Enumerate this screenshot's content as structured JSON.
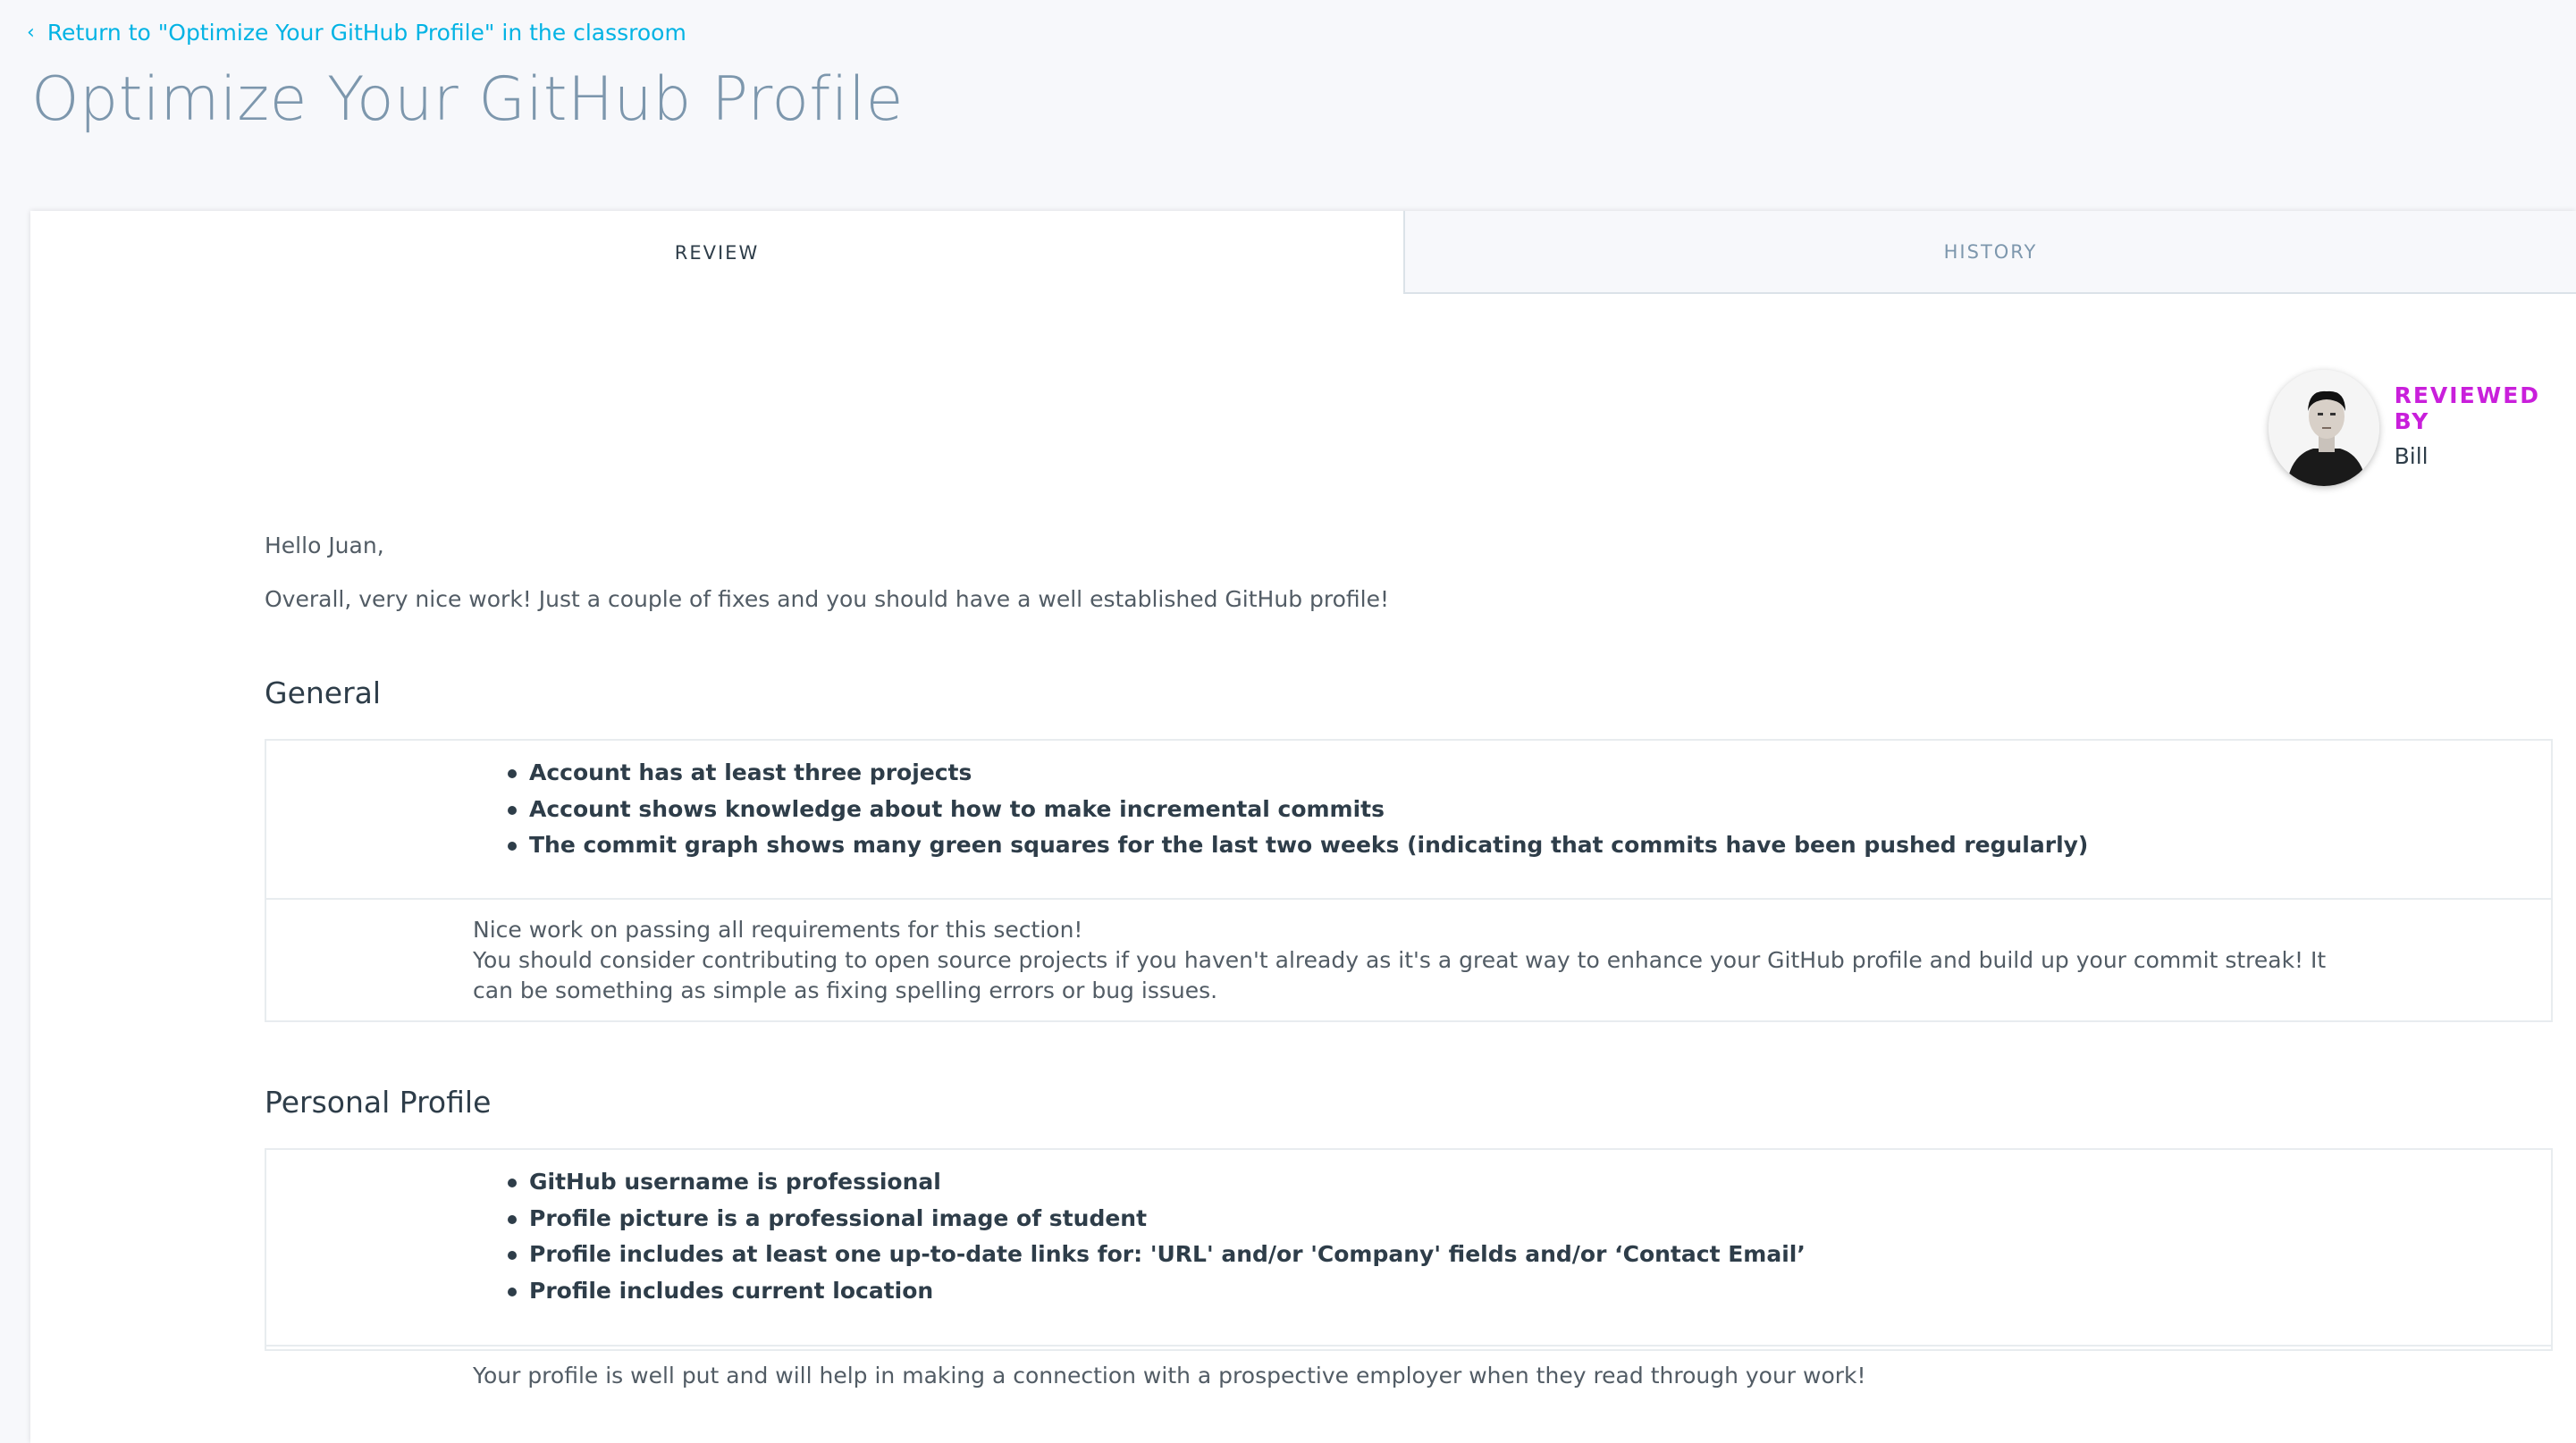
{
  "back_link": "Return to \"Optimize Your GitHub Profile\" in the classroom",
  "page_title": "Optimize Your GitHub Profile",
  "tabs": [
    "REVIEW",
    "HISTORY"
  ],
  "reviewer": {
    "label": "REVIEWED BY",
    "name": "Bill"
  },
  "greeting": "Hello Juan,",
  "overall": "Overall, very nice work! Just a couple of fixes and you should have a well established GitHub profile!",
  "sections": [
    {
      "title": "General",
      "requirements": [
        "Account has at least three projects",
        "Account shows knowledge about how to make incremental commits",
        "The commit graph shows many green squares for the last two weeks (indicating that commits have been pushed regularly)"
      ],
      "comment_lines": [
        "Nice work on passing all requirements for this section!",
        "You should consider contributing to open source projects if you haven't already as it's a great way to enhance your GitHub profile and build up your commit streak! It can be something as simple as fixing spelling errors or bug issues."
      ]
    },
    {
      "title": "Personal Profile",
      "requirements": [
        "GitHub username is professional",
        "Profile picture is a professional image of student",
        "Profile includes at least one up-to-date links for: 'URL' and/or 'Company' fields and/or ‘Contact Email’",
        "Profile includes current location"
      ],
      "comment_lines": [
        "Your profile is well put and will help in making a connection with a prospective employer when they read through your work!"
      ]
    }
  ]
}
